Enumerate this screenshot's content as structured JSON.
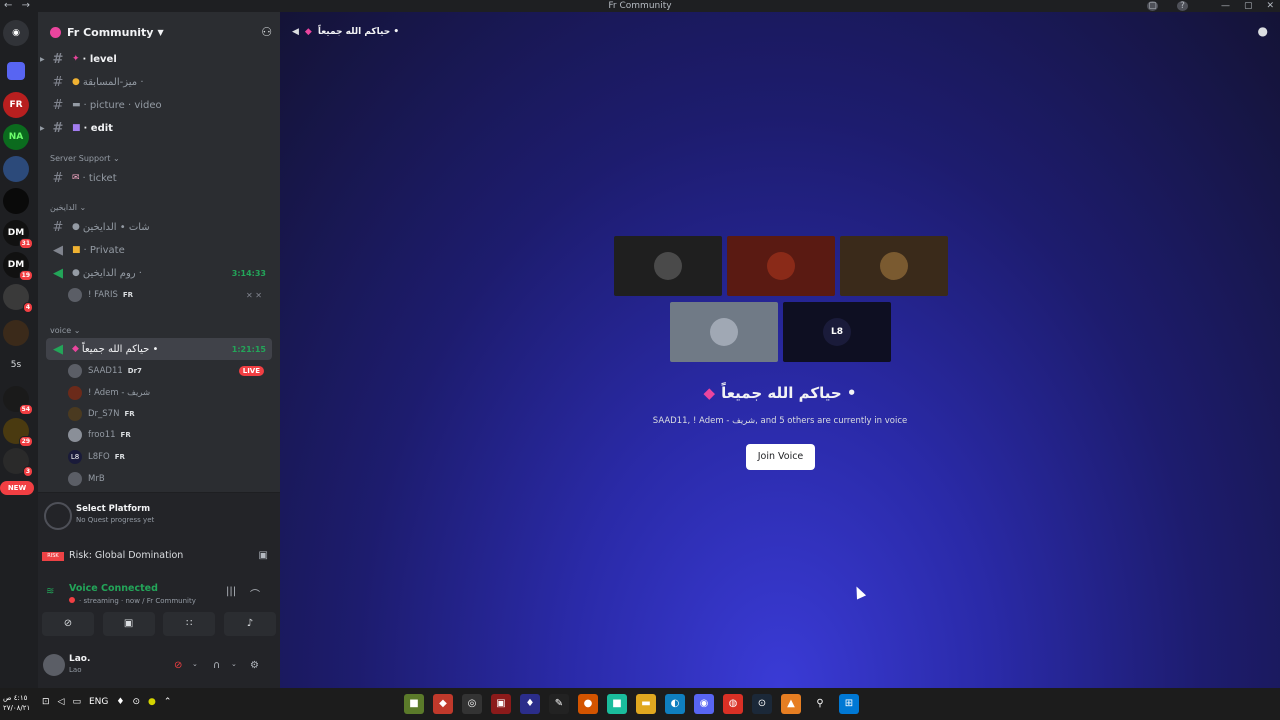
{
  "window": {
    "title": "Fr Community",
    "back": "←",
    "forward": "→"
  },
  "servers": [
    {
      "label": "",
      "badge": ""
    },
    {
      "label": "FR",
      "badge": ""
    },
    {
      "label": "NA",
      "badge": ""
    },
    {
      "label": "",
      "badge": ""
    },
    {
      "label": "",
      "badge": ""
    },
    {
      "label": "DM",
      "badge": "31"
    },
    {
      "label": "DM",
      "badge": "19"
    },
    {
      "label": "",
      "badge": "4"
    },
    {
      "label": "",
      "badge": ""
    },
    {
      "label": "5s",
      "badge": ""
    },
    {
      "label": "",
      "badge": "54"
    },
    {
      "label": "",
      "badge": "29"
    },
    {
      "label": "",
      "badge": "3"
    }
  ],
  "servers_new": "NEW",
  "server": {
    "name": "Fr Community"
  },
  "channels": {
    "level": "· level",
    "mz": "ميز-المسابقة ·",
    "picture": "· picture · video",
    "edit": "· edit",
    "cat_support": "Server Support",
    "ticket": "· ticket",
    "cat_dayhin": "الدايخين",
    "chat_dayhin": "شات • الدايخين",
    "private": "· Private",
    "room_dayhin": "روم الدايخين ·",
    "room_time": "3:14:33",
    "faris": "! FARIS",
    "faris_tag": "FR",
    "cat_voice": "voice",
    "active_voice": "حياكم الله جميعاً •",
    "active_time": "1:21:15"
  },
  "voice_users": [
    {
      "name": "SAAD11",
      "tag": "Dr7",
      "live": "LIVE",
      "av": ""
    },
    {
      "name": "! Adem - شريف",
      "tag": "",
      "live": "",
      "av": ""
    },
    {
      "name": "Dr_S7N",
      "tag": "FR",
      "live": "",
      "av": ""
    },
    {
      "name": "froo11",
      "tag": "FR",
      "live": "",
      "av": ""
    },
    {
      "name": "L8FO",
      "tag": "FR",
      "live": "",
      "av": "L8"
    },
    {
      "name": "MrB",
      "tag": "",
      "live": "",
      "av": ""
    }
  ],
  "quest": {
    "title": "Select Platform",
    "sub": "No Quest progress yet"
  },
  "activity": {
    "game": "Risk: Global Domination",
    "icon": "RISK"
  },
  "voice": {
    "status": "Voice Connected",
    "sub": "· streaming · now / Fr Community"
  },
  "user": {
    "name": "Lao.",
    "sub": "Lao"
  },
  "main": {
    "header": "حياكم الله جميعاً •",
    "title": "حياكم الله جميعاً •",
    "subtitle": "SAAD11, ! Adem - شريف, and 5 others are currently in voice",
    "join": "Join Voice",
    "tiles": [
      {
        "bg": "#1f1f1f",
        "av": ""
      },
      {
        "bg": "#5a1a12",
        "av": ""
      },
      {
        "bg": "#3a2a1a",
        "av": ""
      },
      {
        "bg": "#707a86",
        "av": ""
      },
      {
        "bg": "#0e0f22",
        "av": "L8"
      }
    ]
  },
  "taskbar": {
    "time": "٤:١٥ ص",
    "date": "٢٧/٠٨/٢١",
    "lang": "ENG"
  },
  "colors": {
    "accent": "#5865f2",
    "green": "#23a559",
    "red": "#f23f43",
    "pink": "#eb459e"
  }
}
